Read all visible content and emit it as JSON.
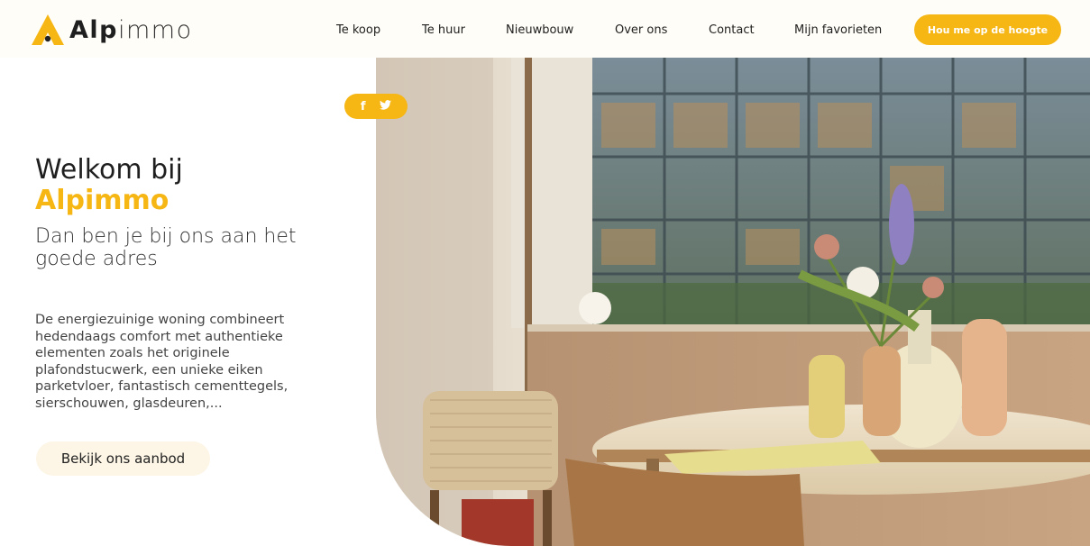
{
  "brand": {
    "name_bold": "Alp",
    "name_light": "immo",
    "accent": "#f6b614"
  },
  "nav": {
    "items": [
      {
        "label": "Te koop"
      },
      {
        "label": "Te huur"
      },
      {
        "label": "Nieuwbouw"
      },
      {
        "label": "Over ons"
      },
      {
        "label": "Contact"
      },
      {
        "label": "Mijn favorieten"
      }
    ],
    "cta_label": "Hou me op de hoogte"
  },
  "hero": {
    "title": "Welkom bij",
    "brand": "Alpimmo",
    "subtitle": "Dan ben je bij ons aan het goede adres",
    "description": "De energiezuinige woning combineert hedendaags comfort met authentieke elementen zoals het originele plafondstucwerk, een unieke eiken parketvloer, fantastisch cementtegels, sierschouwen, glasdeuren,...",
    "button_label": "Bekijk ons aanbod"
  },
  "social": {
    "icons": [
      {
        "name": "facebook-icon",
        "glyph": "f"
      },
      {
        "name": "twitter-icon",
        "glyph": "t"
      }
    ]
  },
  "photo": {
    "subject": "interior-photo"
  }
}
